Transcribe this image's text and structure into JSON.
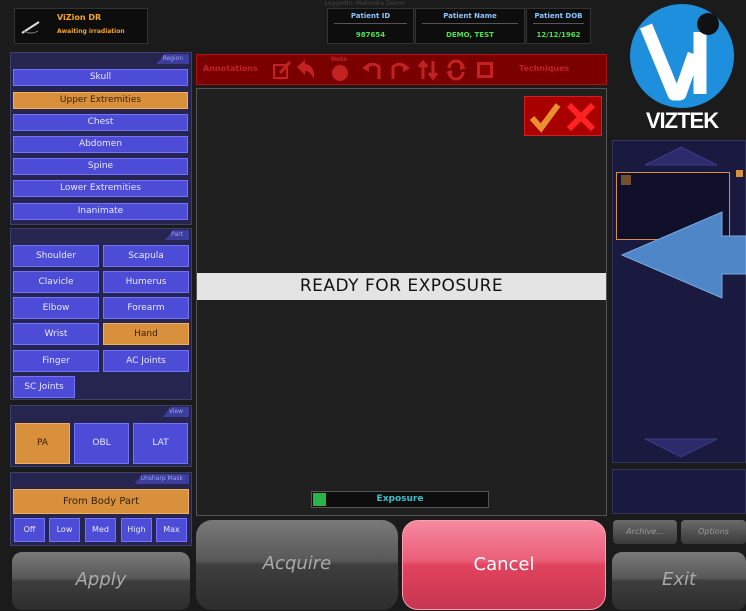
{
  "header": {
    "status_title": "ViZion DR",
    "status_subtitle": "Awaiting irradiation",
    "logged_in": "LoggedIn: Mahindra Devon",
    "patient_id_label": "Patient ID",
    "patient_id": "987654",
    "patient_name_label": "Patient Name",
    "patient_name": "DEMO, TEST",
    "patient_dob_label": "Patient DOB",
    "patient_dob": "12/12/1962"
  },
  "region": {
    "title": "Region",
    "items": [
      "Skull",
      "Upper Extremities",
      "Chest",
      "Abdomen",
      "Spine",
      "Lower Extremities",
      "Inanimate"
    ],
    "selected": "Upper Extremities"
  },
  "part": {
    "title": "Part",
    "items": [
      "Shoulder",
      "Scapula",
      "Clavicle",
      "Humerus",
      "Elbow",
      "Forearm",
      "Wrist",
      "Hand",
      "Finger",
      "AC Joints",
      "SC Joints"
    ],
    "selected": "Hand"
  },
  "view": {
    "title": "View",
    "items": [
      "PA",
      "OBL",
      "LAT"
    ],
    "selected": "PA"
  },
  "unsharp_mask": {
    "title": "Unsharp Mask",
    "from_body_part": "From Body Part",
    "levels": [
      "Off",
      "Low",
      "Med",
      "High",
      "Max"
    ]
  },
  "toolbar": {
    "annotations_label": "Annotations",
    "techniques_label": "Techniques",
    "note_label": "Note"
  },
  "viewer": {
    "ready_text": "READY FOR EXPOSURE",
    "exposure_label": "Exposure"
  },
  "logo": {
    "brand": "VIZTEK"
  },
  "buttons": {
    "apply": "Apply",
    "acquire": "Acquire",
    "cancel": "Cancel",
    "exit": "Exit",
    "archive": "Archive...",
    "options": "Options"
  },
  "colors": {
    "accent_blue": "#4c4cd6",
    "selected_orange": "#d8903c",
    "toolbar_red": "#7a0000",
    "cancel_pink": "#e2435e",
    "logo_blue": "#1e8fdc"
  }
}
